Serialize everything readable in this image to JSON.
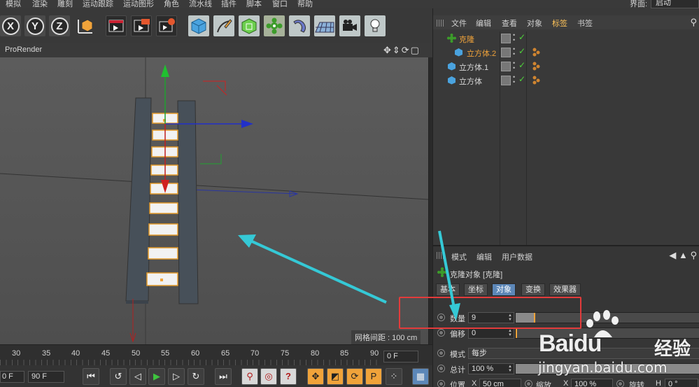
{
  "menubar": {
    "items": [
      "模拟",
      "渲染",
      "雕刻",
      "运动跟踪",
      "运动图形",
      "角色",
      "流水线",
      "插件",
      "脚本",
      "窗口",
      "帮助"
    ],
    "interface_label": "界面:",
    "interface_value": "启动"
  },
  "toolbar": {
    "axis_x": "X",
    "axis_y": "Y",
    "axis_z": "Z",
    "icons": [
      "coordinate-system-icon",
      "render-view-icon",
      "render-picture-viewer-icon",
      "render-settings-icon",
      "cube-icon",
      "pen-spline-icon",
      "subdivision-icon",
      "cloner-icon",
      "deformer-icon",
      "floor-icon",
      "camera-icon",
      "light-icon"
    ]
  },
  "viewport": {
    "title": "ProRender",
    "grid_spacing": "网格间距 : 100 cm"
  },
  "timeline": {
    "ticks": [
      "30",
      "35",
      "40",
      "45",
      "50",
      "55",
      "60",
      "65",
      "70",
      "75",
      "80",
      "85",
      "90"
    ],
    "current_frame": "0 F",
    "start_frame": "0 F",
    "end_frame": "90 F"
  },
  "object_manager": {
    "tabs": [
      "文件",
      "编辑",
      "查看",
      "对象",
      "标签",
      "书签"
    ],
    "active_tab": "标签",
    "objects": [
      {
        "name": "克隆",
        "highlight": true
      },
      {
        "name": "立方体.2",
        "highlight": true
      },
      {
        "name": "立方体.1",
        "highlight": false
      },
      {
        "name": "立方体",
        "highlight": false
      }
    ]
  },
  "attributes": {
    "menu": [
      "模式",
      "编辑",
      "用户数据"
    ],
    "object_title": "克隆对象 [克隆]",
    "tabs": [
      "基本",
      "坐标",
      "对象",
      "变换",
      "效果器"
    ],
    "active_tab": "对象",
    "count_label": "数量",
    "count_value": "9",
    "count_fill": 0.1,
    "offset_label": "偏移",
    "offset_value": "0",
    "mode_label": "模式",
    "mode_value": "每步",
    "total_label": "总计",
    "total_value": "100 %",
    "position_label": "位置",
    "position_x_label": "X",
    "position_x_value": "50 cm",
    "scale_label": "缩放",
    "scale_x_label": "X",
    "scale_x_value": "100 %",
    "rotate_label": "旋转",
    "rotate_h_label": "H",
    "rotate_h_value": "0 °"
  },
  "watermark": {
    "brand": "Baidu",
    "service": "经验",
    "url": "jingyan.baidu.com"
  },
  "colors": {
    "highlight_orange": "#f0a33a",
    "active_tab_blue": "#5c87b8",
    "annotation_red": "#e33b3b",
    "annotation_arrow": "#35c9d6"
  }
}
